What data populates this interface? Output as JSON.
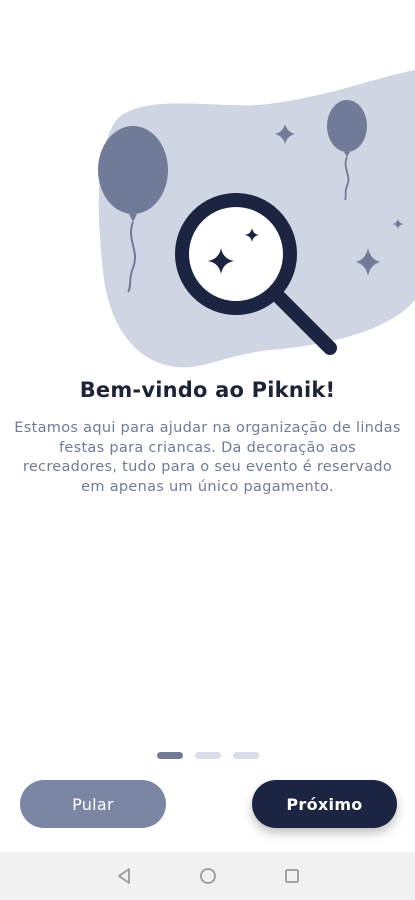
{
  "onboarding": {
    "title": "Bem-vindo ao Piknik!",
    "description": "Estamos aqui para ajudar na organização de lindas festas para criancas. Da decoração aos recreadores, tudo para o seu evento é reservado em apenas um único pagamento.",
    "illustration_icons": [
      "balloon-icon",
      "magnifier-icon",
      "sparkle-icon"
    ],
    "page_indicator": {
      "current": 1,
      "total": 3
    }
  },
  "actions": {
    "skip_label": "Pular",
    "next_label": "Próximo"
  },
  "colors": {
    "primary_dark": "#1b2440",
    "secondary": "#7a86a3",
    "blob": "#cfd5e3",
    "text_muted": "#6f7b97"
  },
  "system_nav": {
    "icons": [
      "back-icon",
      "home-icon",
      "recents-icon"
    ]
  }
}
